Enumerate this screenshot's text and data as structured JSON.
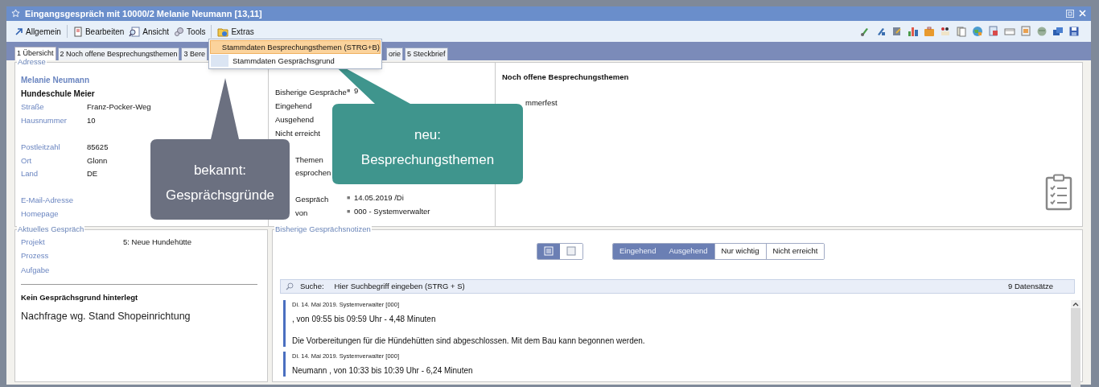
{
  "window": {
    "title": "Eingangsgespräch mit 10000/2 Melanie Neumann [13,11]"
  },
  "menubar": [
    {
      "kind": "arrow",
      "label": "Allgemein"
    },
    {
      "kind": "edit",
      "label": "Bearbeiten"
    },
    {
      "kind": "view",
      "label": "Ansicht"
    },
    {
      "kind": "tools",
      "label": "Tools"
    },
    {
      "kind": "folder",
      "label": "Extras"
    }
  ],
  "dropdown": [
    {
      "label": "Stammdaten Besprechungsthemen (STRG+B)",
      "selected": true
    },
    {
      "label": "Stammdaten Gesprächsgrund",
      "selected": false
    }
  ],
  "tabs": [
    {
      "label": "1 Übersicht",
      "selected": true
    },
    {
      "label": "2 Noch offene Besprechungsthemen",
      "selected": false
    },
    {
      "label": "3 Bere",
      "selected": false
    },
    {
      "label": "orie",
      "selected": false
    },
    {
      "label": "5 Steckbrief",
      "selected": false
    }
  ],
  "address": {
    "legend": "Adresse",
    "name": "Melanie Neumann",
    "company": "Hundeschule Meier",
    "field_groups": [
      [
        {
          "label": "Straße",
          "value": "Franz-Pocker-Weg"
        },
        {
          "label": "Hausnummer",
          "value": "10"
        }
      ],
      [
        {
          "label": "Postleitzahl",
          "value": "85625"
        },
        {
          "label": "Ort",
          "value": "Glonn"
        },
        {
          "label": "Land",
          "value": "DE"
        }
      ],
      [
        {
          "label": "E-Mail-Adresse"
        },
        {
          "label": "Homepage"
        }
      ]
    ]
  },
  "stats": [
    [
      {
        "label": "Bisherige Gespräche",
        "bullet": "■",
        "value": "9",
        "clipped": false
      },
      {
        "label": "Eingehend",
        "clipped": false
      },
      {
        "label": "Ausgehend",
        "clipped": false
      },
      {
        "label": "Nicht erreicht",
        "clipped": false
      }
    ],
    [
      {
        "label": "Themen",
        "clipped": true
      },
      {
        "label": "esprochen",
        "clipped": true
      }
    ],
    [
      {
        "label": "Gespräch",
        "bullet": "■",
        "value": "14.05.2019 /Di",
        "clipped": true
      },
      {
        "label": "von",
        "bullet": "■",
        "value": "000 - Systemverwalter",
        "clipped": true
      }
    ]
  ],
  "open_topics": {
    "title": "Noch offene Besprechungsthemen",
    "items": [
      "mmerfest"
    ]
  },
  "current": {
    "legend": "Aktuelles Gespräch",
    "fields": [
      {
        "label": "Projekt",
        "value": "5: Neue Hundehütte"
      },
      {
        "label": "Prozess"
      },
      {
        "label": "Aufgabe"
      }
    ],
    "reason_title": "Kein Gesprächsgrund hinterlegt",
    "reason": "Nachfrage wg. Stand Shopeinrichtung"
  },
  "notes": {
    "legend": "Bisherige Gesprächsnotizen",
    "views": [
      {
        "kind": "list",
        "selected": true
      },
      {
        "kind": "grid",
        "selected": false
      }
    ],
    "filters": [
      {
        "label": "Eingehend",
        "selected": true
      },
      {
        "label": "Ausgehend",
        "selected": true
      },
      {
        "label": "Nur wichtig",
        "selected": false
      },
      {
        "label": "Nicht erreicht",
        "selected": false
      }
    ],
    "search": {
      "label": "Suche:",
      "placeholder": "Hier Suchbegriff eingeben (STRG + S)"
    },
    "count": "9 Datensätze",
    "entries": [
      {
        "header": "Di. 14. Mai 2019. Systemverwalter [000]",
        "time": ", von 09:55 bis 09:59 Uhr - 4,48 Minuten",
        "text": "Die Vorbereitungen für die Hündehütten sind abgeschlossen. Mit dem Bau kann begonnen werden."
      },
      {
        "header": "Di. 14. Mai 2019. Systemverwalter [000]",
        "time": "Neumann , von 10:33 bis 10:39 Uhr - 6,24 Minuten"
      }
    ]
  },
  "callouts": [
    {
      "kind": "gray",
      "lines": [
        "bekannt:",
        "Gesprächsgründe"
      ]
    },
    {
      "kind": "teal",
      "lines": [
        "neu:",
        "Besprechungsthemen"
      ]
    }
  ]
}
